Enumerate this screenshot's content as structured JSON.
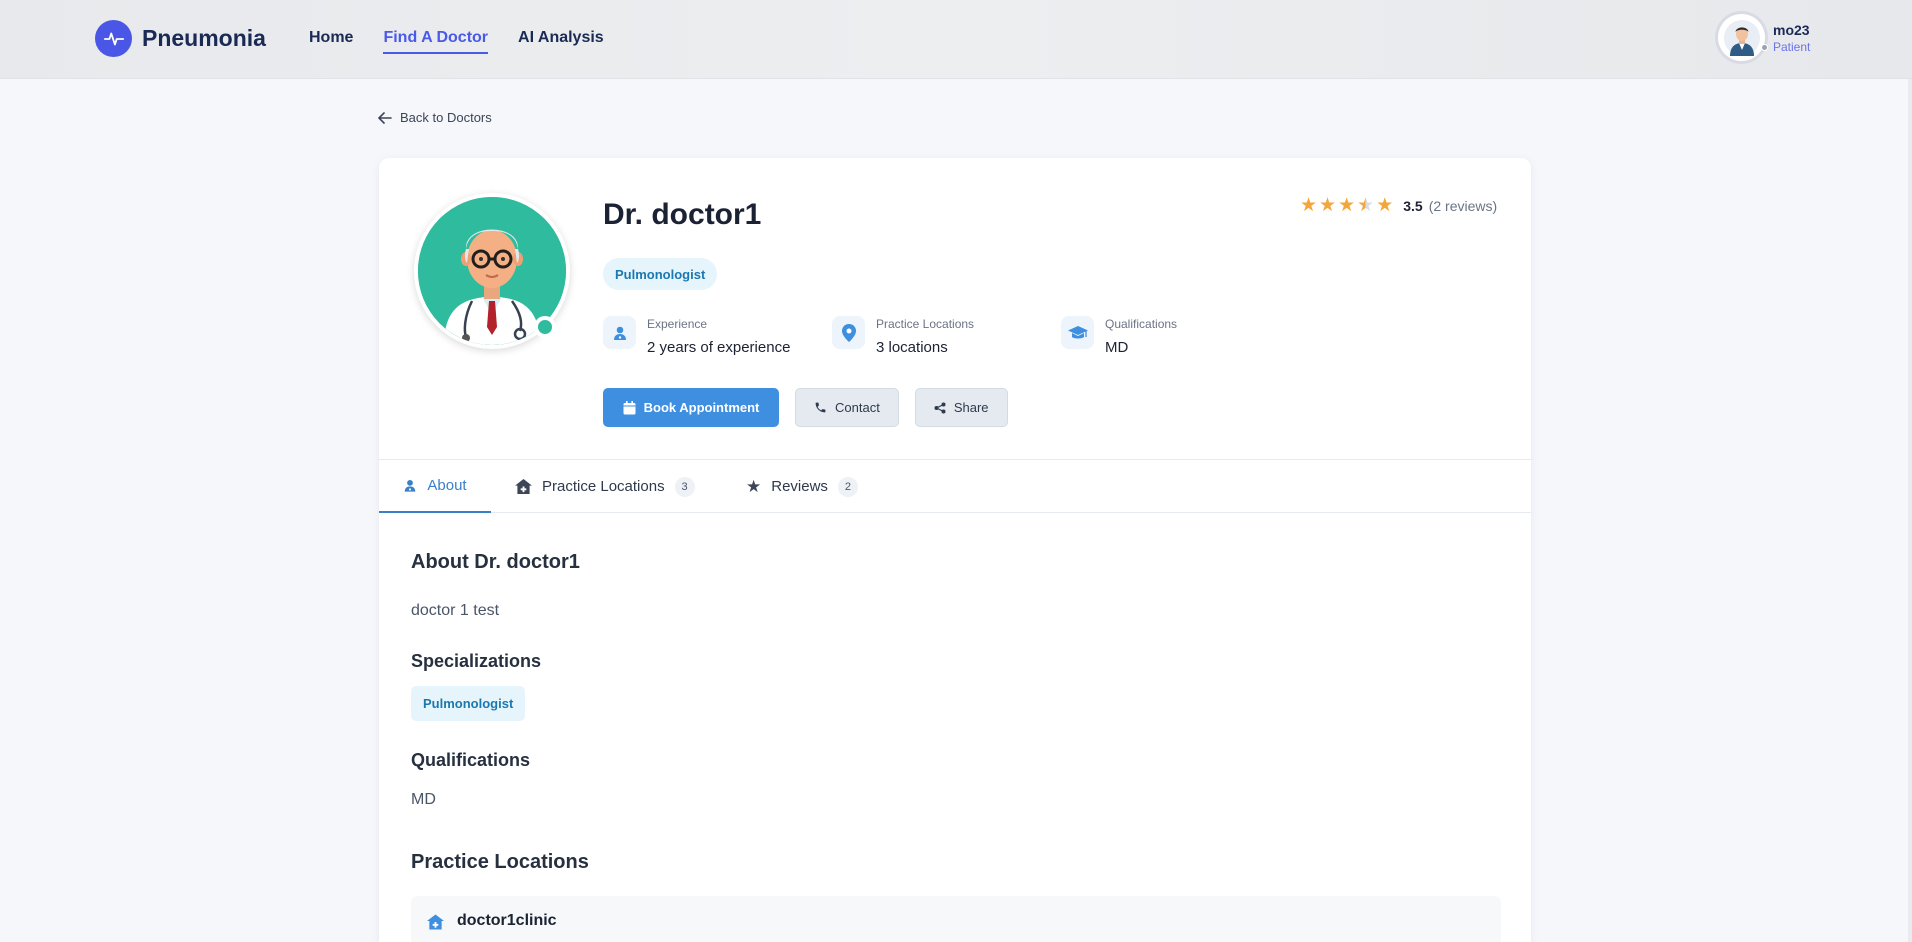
{
  "navbar": {
    "brand": "Pneumonia",
    "links": [
      {
        "label": "Home"
      },
      {
        "label": "Find A Doctor"
      },
      {
        "label": "AI Analysis"
      }
    ],
    "user": {
      "name": "mo23",
      "role": "Patient"
    }
  },
  "back_label": "Back to Doctors",
  "doctor": {
    "name": "Dr. doctor1",
    "specialty": "Pulmonologist",
    "rating": {
      "value": "3.5",
      "reviews": "(2 reviews)",
      "stars": 3.5,
      "max": 5
    },
    "stats": [
      {
        "label": "Experience",
        "value": "2 years of experience",
        "icon": "user-doctor-icon"
      },
      {
        "label": "Practice Locations",
        "value": "3 locations",
        "icon": "map-pin-icon"
      },
      {
        "label": "Qualifications",
        "value": "MD",
        "icon": "graduation-cap-icon"
      }
    ]
  },
  "actions": {
    "book": "Book Appointment",
    "contact": "Contact",
    "share": "Share"
  },
  "tabs": [
    {
      "label": "About",
      "count": ""
    },
    {
      "label": "Practice Locations",
      "count": "3"
    },
    {
      "label": "Reviews",
      "count": "2"
    }
  ],
  "about": {
    "title": "About Dr. doctor1",
    "bio": "doctor 1 test",
    "specializations_title": "Specializations",
    "specialization": "Pulmonologist",
    "qualifications_title": "Qualifications",
    "qualifications": "MD",
    "locations_title": "Practice Locations",
    "first_location": "doctor1clinic"
  },
  "colors": {
    "accent": "#4a5ae8",
    "primary_button": "#3e8fe0",
    "star": "#f3a63b",
    "avatar_bg": "#2fbc9e"
  }
}
